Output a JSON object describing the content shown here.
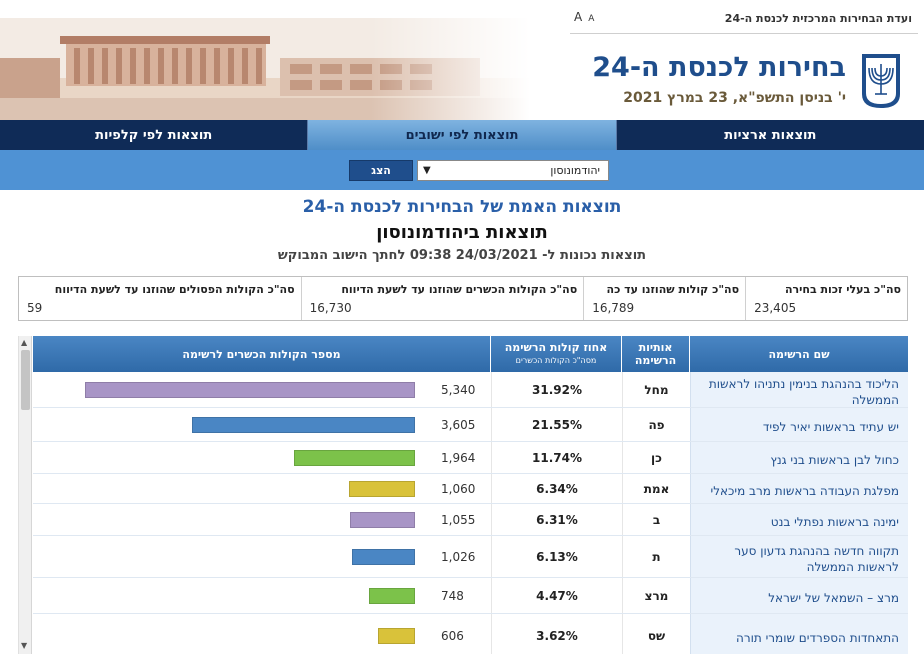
{
  "header": {
    "committee": "ועדת הבחירות המרכזית לכנסת ה-24",
    "a11y_large": "A",
    "a11y_small": "A",
    "title": "בחירות לכנסת ה-24",
    "date": "י' בניסן התשפ\"א, 23 במרץ 2021"
  },
  "nav": {
    "tabs": [
      {
        "label": "תוצאות ארציות"
      },
      {
        "label": "תוצאות לפי ישובים"
      },
      {
        "label": "תוצאות לפי קלפיות"
      }
    ]
  },
  "filter": {
    "selected": "יהודמונוסון",
    "show_button": "הצג"
  },
  "results": {
    "heading": "תוצאות האמת של הבחירות לכנסת ה-24",
    "subheading": "תוצאות ביהודמונוסון",
    "timestamp": "תוצאות נכונות ל-  24/03/2021  09:38  לחתך הישוב המבוקש"
  },
  "summary": [
    {
      "label": "סה\"כ בעלי זכות בחירה",
      "value": "23,405"
    },
    {
      "label": "סה\"כ קולות שהוזנו עד כה",
      "value": "16,789"
    },
    {
      "label": "סה\"כ הקולות הכשרים שהוזנו עד לשעת הדיווח",
      "value": "16,730"
    },
    {
      "label": "סה\"כ הקולות הפסולים שהוזנו עד לשעת הדיווח",
      "value": "59"
    }
  ],
  "table": {
    "headers": {
      "name": "שם הרשימה",
      "letters": "אותיות הרשימה",
      "pct": "אחוז קולות הרשימה",
      "pct_sub": "מסה\"כ הקולות הכשרים",
      "votes": "מספר הקולות הכשרים לרשימה"
    },
    "rows": [
      {
        "name": "הליכוד בהנהגת בנימין נתניהו לראשות הממשלה",
        "letters": "מחל",
        "pct": "31.92%",
        "votes": "5,340",
        "votes_num": 5340,
        "color": "#a895c6"
      },
      {
        "name": "יש עתיד בראשות יאיר לפיד",
        "letters": "פה",
        "pct": "21.55%",
        "votes": "3,605",
        "votes_num": 3605,
        "color": "#4a86c4"
      },
      {
        "name": "כחול לבן בראשות בני גנץ",
        "letters": "כן",
        "pct": "11.74%",
        "votes": "1,964",
        "votes_num": 1964,
        "color": "#7cc24a"
      },
      {
        "name": "מפלגת העבודה בראשות מרב מיכאלי",
        "letters": "אמת",
        "pct": "6.34%",
        "votes": "1,060",
        "votes_num": 1060,
        "color": "#d9c23a"
      },
      {
        "name": "ימינה בראשות נפתלי בנט",
        "letters": "ב",
        "pct": "6.31%",
        "votes": "1,055",
        "votes_num": 1055,
        "color": "#a895c6"
      },
      {
        "name": "תקווה חדשה בהנהגת גדעון סער לראשות הממשלה",
        "letters": "ת",
        "pct": "6.13%",
        "votes": "1,026",
        "votes_num": 1026,
        "color": "#4a86c4"
      },
      {
        "name": "מרצ – השמאל של ישראל",
        "letters": "מרצ",
        "pct": "4.47%",
        "votes": "748",
        "votes_num": 748,
        "color": "#7cc24a"
      },
      {
        "name": "התאחדות הספרדים שומרי תורה",
        "letters": "שס",
        "pct": "3.62%",
        "votes": "606",
        "votes_num": 606,
        "color": "#d9c23a"
      }
    ]
  },
  "colors": {
    "navy": "#0f2b57",
    "accent_blue": "#4f92d4",
    "title_blue": "#1f4e8c"
  }
}
